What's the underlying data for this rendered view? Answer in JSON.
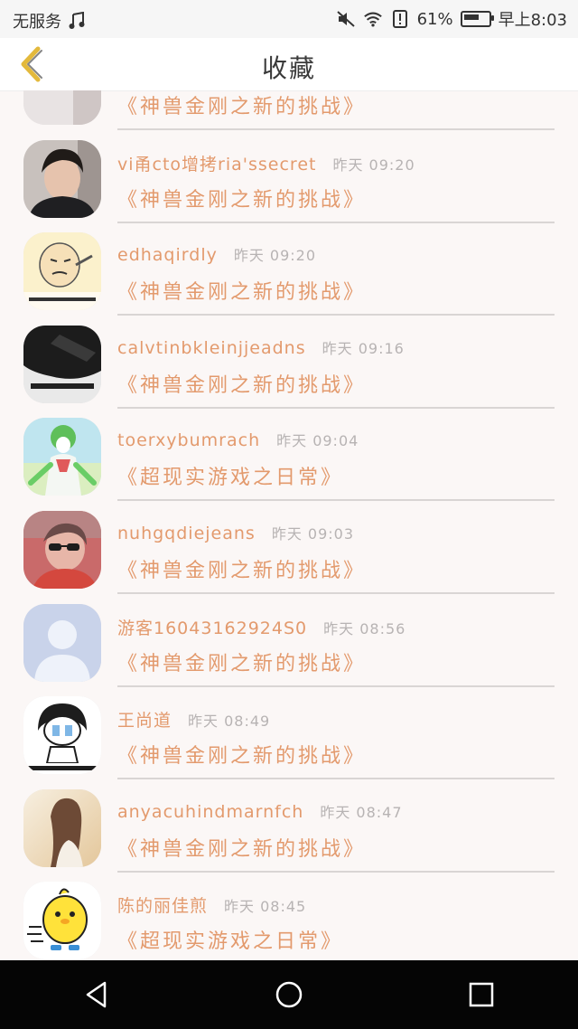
{
  "status_bar": {
    "carrier": "无服务",
    "battery": "61%",
    "battery_level": 0.61,
    "time": "早上8:03",
    "icons": [
      "music-icon",
      "mute-icon",
      "wifi-icon",
      "alert-sim-icon",
      "battery-icon"
    ]
  },
  "header": {
    "title": "收藏",
    "back_icon": "chevron-left-icon",
    "accent_color": "#e3b93c"
  },
  "favorites": [
    {
      "username": "",
      "time": "",
      "game": "《神兽金刚之新的挑战》",
      "avatar_kind": "partial"
    },
    {
      "username": "vi甬cto增拷ria'ssecret",
      "time": "昨天 09:20",
      "game": "《神兽金刚之新的挑战》",
      "avatar_kind": "person-dark"
    },
    {
      "username": "edhaqirdly",
      "time": "昨天 09:20",
      "game": "《神兽金刚之新的挑战》",
      "avatar_kind": "meme-face"
    },
    {
      "username": "calvtinbkleinjjeadns",
      "time": "昨天 09:16",
      "game": "《神兽金刚之新的挑战》",
      "avatar_kind": "bw-photo"
    },
    {
      "username": "toerxybumrach",
      "time": "昨天 09:04",
      "game": "《超现实游戏之日常》",
      "avatar_kind": "anime-green"
    },
    {
      "username": "nuhgqdiejeans",
      "time": "昨天 09:03",
      "game": "《神兽金刚之新的挑战》",
      "avatar_kind": "sunglasses"
    },
    {
      "username": "游客16043162924S0",
      "time": "昨天 08:56",
      "game": "《神兽金刚之新的挑战》",
      "avatar_kind": "default"
    },
    {
      "username": "王尚道",
      "time": "昨天 08:49",
      "game": "《神兽金刚之新的挑战》",
      "avatar_kind": "cartoon-crying"
    },
    {
      "username": "anyacuhindmarnfch",
      "time": "昨天 08:47",
      "game": "《神兽金刚之新的挑战》",
      "avatar_kind": "girl-photo"
    },
    {
      "username": "陈的丽佳煎",
      "time": "昨天 08:45",
      "game": "《超现实游戏之日常》",
      "avatar_kind": "yellow-chick"
    }
  ],
  "nav_bar": {
    "buttons": [
      "back-triangle-icon",
      "home-circle-icon",
      "recents-square-icon"
    ]
  }
}
